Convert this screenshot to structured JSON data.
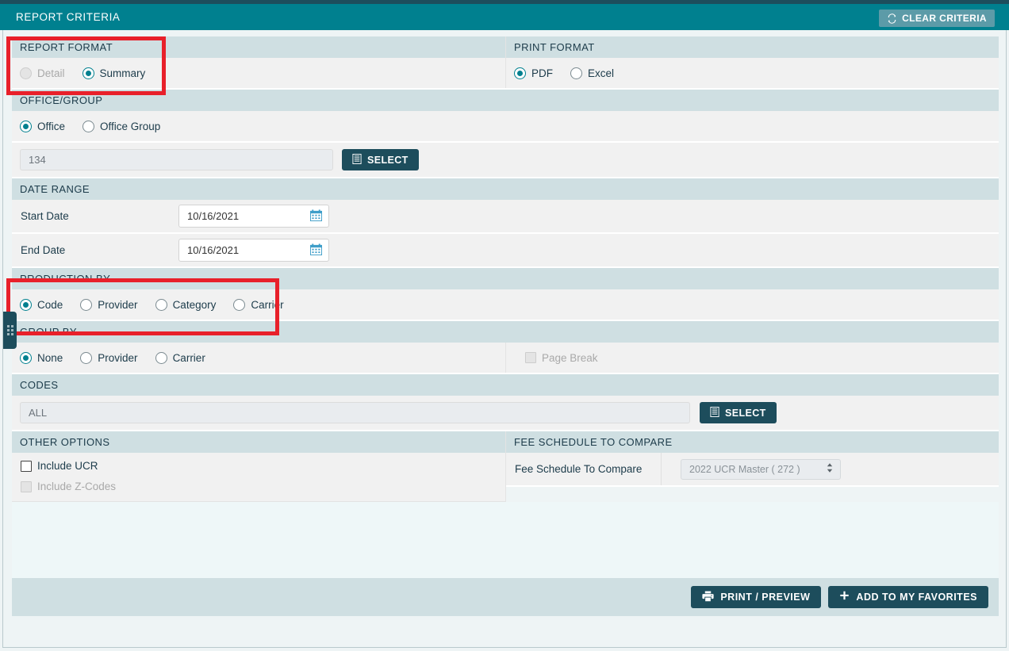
{
  "header": {
    "title": "REPORT CRITERIA",
    "clear_button": "CLEAR CRITERIA",
    "clear_icon": "refresh-icon"
  },
  "sections": {
    "report_format": {
      "title": "REPORT FORMAT",
      "options": [
        {
          "label": "Detail",
          "selected": false,
          "disabled": true
        },
        {
          "label": "Summary",
          "selected": true,
          "disabled": false
        }
      ]
    },
    "print_format": {
      "title": "PRINT FORMAT",
      "options": [
        {
          "label": "PDF",
          "selected": true,
          "disabled": false
        },
        {
          "label": "Excel",
          "selected": false,
          "disabled": false
        }
      ]
    },
    "office_group": {
      "title": "OFFICE/GROUP",
      "options": [
        {
          "label": "Office",
          "selected": true
        },
        {
          "label": "Office Group",
          "selected": false
        }
      ],
      "office_value": "134",
      "select_button": "SELECT",
      "select_icon": "list-icon"
    },
    "date_range": {
      "title": "DATE RANGE",
      "start_label": "Start Date",
      "start_value": "10/16/2021",
      "end_label": "End Date",
      "end_value": "10/16/2021",
      "calendar_icon": "calendar-icon"
    },
    "production_by": {
      "title": "PRODUCTION BY",
      "options": [
        {
          "label": "Code",
          "selected": true
        },
        {
          "label": "Provider",
          "selected": false
        },
        {
          "label": "Category",
          "selected": false
        },
        {
          "label": "Carrier",
          "selected": false
        }
      ]
    },
    "group_by": {
      "title": "GROUP BY",
      "options": [
        {
          "label": "None",
          "selected": true
        },
        {
          "label": "Provider",
          "selected": false
        },
        {
          "label": "Carrier",
          "selected": false
        }
      ],
      "page_break_label": "Page Break",
      "page_break_checked": false,
      "page_break_disabled": true
    },
    "codes": {
      "title": "CODES",
      "value": "ALL",
      "select_button": "SELECT",
      "select_icon": "list-icon"
    },
    "other_options": {
      "title": "OTHER OPTIONS",
      "include_ucr_label": "Include UCR",
      "include_ucr_checked": false,
      "include_zcodes_label": "Include Z-Codes",
      "include_zcodes_checked": false,
      "include_zcodes_disabled": true
    },
    "fee_schedule": {
      "title": "FEE SCHEDULE TO COMPARE",
      "field_label": "Fee Schedule To Compare",
      "selected_value": "2022 UCR Master ( 272 )"
    }
  },
  "footer": {
    "print_preview": "PRINT / PREVIEW",
    "print_icon": "printer-icon",
    "add_favorites": "ADD TO MY FAVORITES",
    "plus_icon": "plus-icon"
  },
  "colors": {
    "header_teal": "#00808f",
    "top_navy": "#1d4d5c",
    "section_header": "#cfdfe2",
    "row_bg": "#f1f1f1",
    "button_dark": "#1d4d5c",
    "accent_red": "#e8202a"
  }
}
